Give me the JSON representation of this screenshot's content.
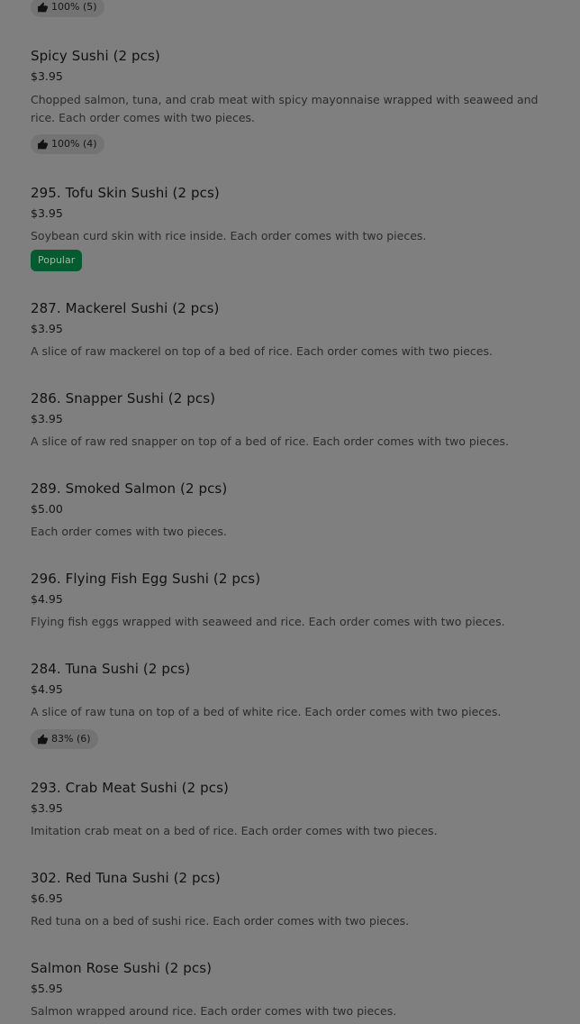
{
  "menu": {
    "items": [
      {
        "rating": "100% (5)"
      },
      {
        "name": "Spicy Sushi (2 pcs)",
        "price": "$3.95",
        "description": "Chopped salmon, tuna, and crab meat with spicy mayonnaise wrapped with seaweed and rice. Each order comes with two pieces.",
        "rating": "100% (4)"
      },
      {
        "name": "295. Tofu Skin Sushi (2 pcs)",
        "price": "$3.95",
        "description": "Soybean curd skin with rice inside. Each order comes with two pieces.",
        "badge": "Popular"
      },
      {
        "name": "287. Mackerel Sushi (2 pcs)",
        "price": "$3.95",
        "description": "A slice of raw mackerel on top of a bed of rice. Each order comes with two pieces."
      },
      {
        "name": "286. Snapper Sushi (2 pcs)",
        "price": "$3.95",
        "description": "A slice of raw red snapper on top of a bed of rice. Each order comes with two pieces."
      },
      {
        "name": "289. Smoked Salmon (2 pcs)",
        "price": "$5.00",
        "description": "Each order comes with two pieces."
      },
      {
        "name": "296. Flying Fish Egg Sushi (2 pcs)",
        "price": "$4.95",
        "description": "Flying fish eggs wrapped with seaweed and rice. Each order comes with two pieces."
      },
      {
        "name": "284. Tuna Sushi (2 pcs)",
        "price": "$4.95",
        "description": "A slice of raw tuna on top of a bed of white rice. Each order comes with two pieces.",
        "rating": "83% (6)"
      },
      {
        "name": "293. Crab Meat Sushi (2 pcs)",
        "price": "$3.95",
        "description": "Imitation crab meat on a bed of rice. Each order comes with two pieces."
      },
      {
        "name": "302. Red Tuna Sushi (2 pcs)",
        "price": "$6.95",
        "description": "Red tuna on a bed of sushi rice. Each order comes with two pieces."
      },
      {
        "name": "Salmon Rose Sushi (2 pcs)",
        "price": "$5.95",
        "description": "Salmon wrapped around rice. Each order comes with two pieces."
      }
    ]
  },
  "icons": {
    "rating": "thumbs-up-icon"
  },
  "colors": {
    "overlay_background": "#7f7f7f",
    "popular_badge": "#055b2f",
    "rating_pill": "#737373"
  }
}
